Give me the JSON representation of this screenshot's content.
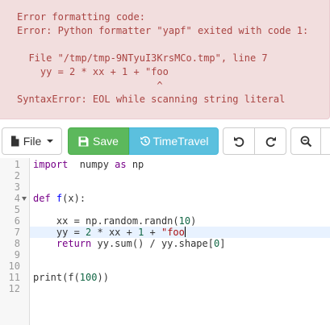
{
  "error": {
    "lines": [
      "Error formatting code:",
      "Error: Python formatter \"yapf\" exited with code 1:",
      "",
      "  File \"/tmp/tmp-9NTyuI3KrsMCo.tmp\", line 7",
      "    yy = 2 * xx + 1 + \"foo",
      "                        ^",
      "SyntaxError: EOL while scanning string literal"
    ]
  },
  "toolbar": {
    "file_label": "File",
    "save_label": "Save",
    "timetravel_label": "TimeTravel"
  },
  "editor": {
    "active_line": 7,
    "line_numbers": [
      "1",
      "2",
      "3",
      "4",
      "5",
      "6",
      "7",
      "8",
      "9",
      "10",
      "11",
      "12"
    ],
    "lines": [
      {
        "n": 1,
        "tokens": [
          [
            "kw",
            "import"
          ],
          [
            "",
            "  numpy "
          ],
          [
            "kw",
            "as"
          ],
          [
            "",
            " np"
          ]
        ]
      },
      {
        "n": 2,
        "tokens": []
      },
      {
        "n": 3,
        "tokens": []
      },
      {
        "n": 4,
        "tokens": [
          [
            "kw",
            "def"
          ],
          [
            "",
            " "
          ],
          [
            "def",
            "f"
          ],
          [
            "",
            "(x):"
          ]
        ]
      },
      {
        "n": 5,
        "tokens": []
      },
      {
        "n": 6,
        "tokens": [
          [
            "",
            "    xx = np.random.randn("
          ],
          [
            "num",
            "10"
          ],
          [
            "",
            ")"
          ]
        ]
      },
      {
        "n": 7,
        "tokens": [
          [
            "",
            "    yy = "
          ],
          [
            "num",
            "2"
          ],
          [
            "",
            " * xx + "
          ],
          [
            "num",
            "1"
          ],
          [
            "",
            " + "
          ],
          [
            "str",
            "\"foo"
          ]
        ]
      },
      {
        "n": 8,
        "tokens": [
          [
            "",
            "    "
          ],
          [
            "kw",
            "return"
          ],
          [
            "",
            " yy.sum() / yy.shape["
          ],
          [
            "num",
            "0"
          ],
          [
            "",
            "]"
          ]
        ]
      },
      {
        "n": 9,
        "tokens": []
      },
      {
        "n": 10,
        "tokens": []
      },
      {
        "n": 11,
        "tokens": [
          [
            "",
            "print(f("
          ],
          [
            "num",
            "100"
          ],
          [
            "",
            "))"
          ]
        ]
      },
      {
        "n": 12,
        "tokens": []
      }
    ]
  }
}
